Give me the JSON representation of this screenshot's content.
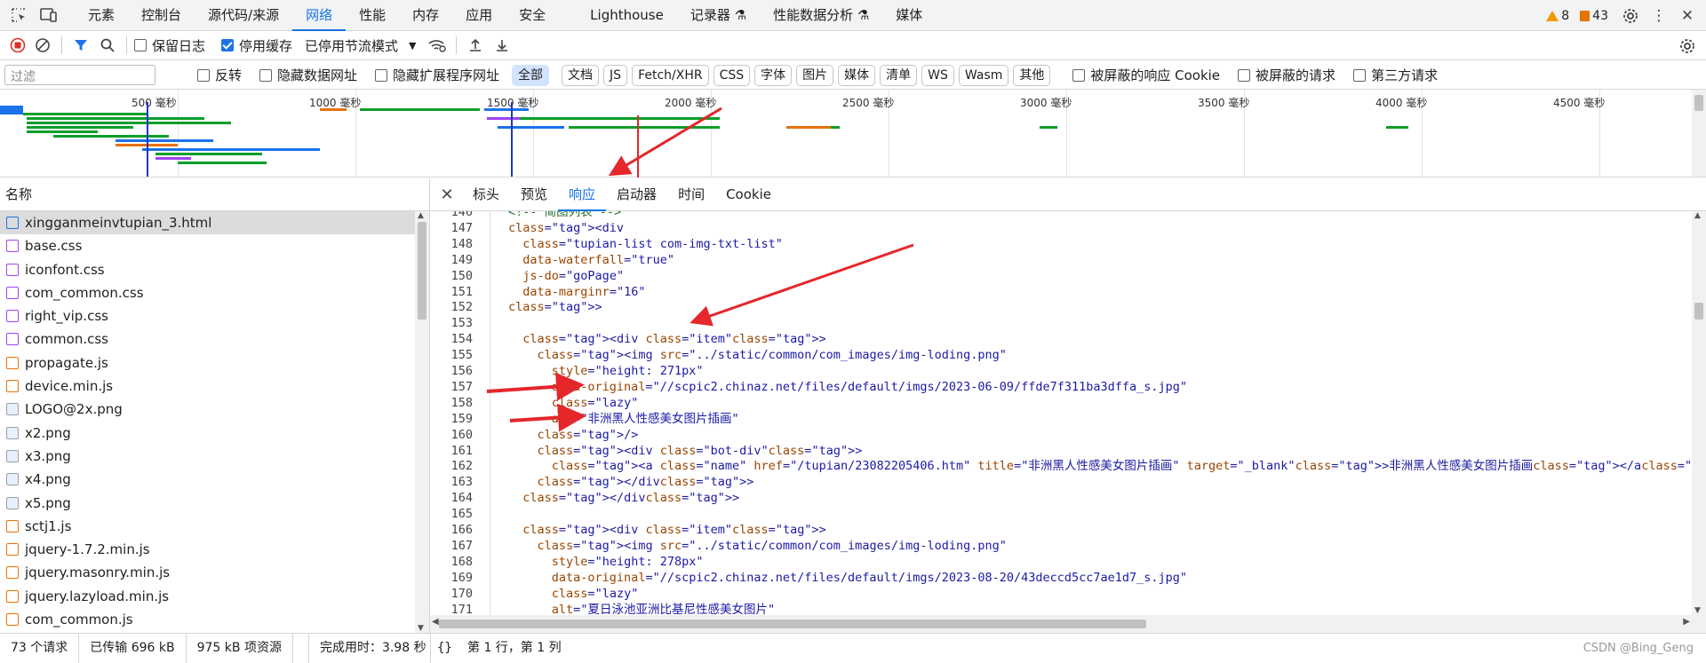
{
  "main_tabs": [
    "元素",
    "控制台",
    "源代码/来源",
    "网络",
    "性能",
    "内存",
    "应用",
    "安全",
    "Lighthouse",
    "记录器",
    "性能数据分析",
    "媒体"
  ],
  "active_tab": "网络",
  "warnings_count": "8",
  "issues_count": "43",
  "toolbar": {
    "preserve_log": "保留日志",
    "disable_cache": "停用缓存",
    "throttle": "已停用节流模式"
  },
  "filter": {
    "placeholder": "过滤",
    "invert": "反转",
    "hide_data_urls": "隐藏数据网址",
    "hide_ext_urls": "隐藏扩展程序网址",
    "types": [
      "全部",
      "文档",
      "JS",
      "Fetch/XHR",
      "CSS",
      "字体",
      "图片",
      "媒体",
      "清单",
      "WS",
      "Wasm",
      "其他"
    ],
    "blocked_cookies": "被屏蔽的响应 Cookie",
    "blocked_requests": "被屏蔽的请求",
    "third_party": "第三方请求"
  },
  "timeline_ticks": [
    "500 毫秒",
    "1000 毫秒",
    "1500 毫秒",
    "2000 毫秒",
    "2500 毫秒",
    "3000 毫秒",
    "3500 毫秒",
    "4000 毫秒",
    "4500 毫秒"
  ],
  "requests": {
    "header": "名称",
    "items": [
      {
        "name": "xingganmeinvtupian_3.html",
        "type": "html"
      },
      {
        "name": "base.css",
        "type": "css"
      },
      {
        "name": "iconfont.css",
        "type": "css"
      },
      {
        "name": "com_common.css",
        "type": "css"
      },
      {
        "name": "right_vip.css",
        "type": "css"
      },
      {
        "name": "common.css",
        "type": "css"
      },
      {
        "name": "propagate.js",
        "type": "js"
      },
      {
        "name": "device.min.js",
        "type": "js"
      },
      {
        "name": "LOGO@2x.png",
        "type": "img"
      },
      {
        "name": "x2.png",
        "type": "img"
      },
      {
        "name": "x3.png",
        "type": "img"
      },
      {
        "name": "x4.png",
        "type": "img"
      },
      {
        "name": "x5.png",
        "type": "img"
      },
      {
        "name": "sctj1.js",
        "type": "js"
      },
      {
        "name": "jquery-1.7.2.min.js",
        "type": "js"
      },
      {
        "name": "jquery.masonry.min.js",
        "type": "js"
      },
      {
        "name": "jquery.lazyload.min.js",
        "type": "js"
      },
      {
        "name": "com_common.js",
        "type": "js"
      }
    ]
  },
  "detail_tabs": [
    "标头",
    "预览",
    "响应",
    "启动器",
    "时间",
    "Cookie"
  ],
  "detail_active": "响应",
  "code_lines": [
    {
      "n": "146",
      "t": "<!-- 简图列表 -->"
    },
    {
      "n": "147",
      "t": "<div"
    },
    {
      "n": "148",
      "t": "  class=\"tupian-list com-img-txt-list\""
    },
    {
      "n": "149",
      "t": "  data-waterfall=\"true\""
    },
    {
      "n": "150",
      "t": "  js-do=\"goPage\""
    },
    {
      "n": "151",
      "t": "  data-marginr=\"16\""
    },
    {
      "n": "152",
      "t": ">"
    },
    {
      "n": "153",
      "t": ""
    },
    {
      "n": "154",
      "t": "  <div class=\"item\">"
    },
    {
      "n": "155",
      "t": "    <img src=\"../static/common/com_images/img-loding.png\""
    },
    {
      "n": "156",
      "t": "      style=\"height: 271px\""
    },
    {
      "n": "157",
      "t": "      data-original=\"//scpic2.chinaz.net/files/default/imgs/2023-06-09/ffde7f311ba3dffa_s.jpg\""
    },
    {
      "n": "158",
      "t": "      class=\"lazy\""
    },
    {
      "n": "159",
      "t": "      alt=\"非洲黑人性感美女图片插画\""
    },
    {
      "n": "160",
      "t": "    />"
    },
    {
      "n": "161",
      "t": "    <div class=\"bot-div\">"
    },
    {
      "n": "162",
      "t": "      <a class=\"name\" href=\"/tupian/23082205406.htm\" title=\"非洲黑人性感美女图片插画\" target=\"_blank\">非洲黑人性感美女图片插画</a>"
    },
    {
      "n": "163",
      "t": "    </div>"
    },
    {
      "n": "164",
      "t": "  </div>"
    },
    {
      "n": "165",
      "t": ""
    },
    {
      "n": "166",
      "t": "  <div class=\"item\">"
    },
    {
      "n": "167",
      "t": "    <img src=\"../static/common/com_images/img-loding.png\""
    },
    {
      "n": "168",
      "t": "      style=\"height: 278px\""
    },
    {
      "n": "169",
      "t": "      data-original=\"//scpic2.chinaz.net/files/default/imgs/2023-08-20/43deccd5cc7ae1d7_s.jpg\""
    },
    {
      "n": "170",
      "t": "      class=\"lazy\""
    },
    {
      "n": "171",
      "t": "      alt=\"夏日泳池亚洲比基尼性感美女图片\""
    }
  ],
  "status": {
    "requests": "73 个请求",
    "transferred": "已传输 696 kB",
    "resources": "975 kB 项资源",
    "finish": "完成用时：3.98 秒",
    "cursor": "第 1 行，第 1 列",
    "watermark": "CSDN @Bing_Geng"
  },
  "colors": {
    "accent": "#1a73e8",
    "annotation": "#e5262b"
  }
}
